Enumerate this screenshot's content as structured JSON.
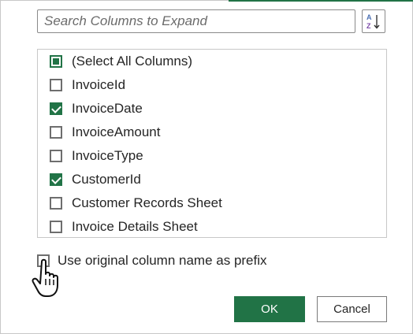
{
  "search": {
    "placeholder": "Search Columns to Expand",
    "value": ""
  },
  "sort_button": {
    "icon": "sort-az-icon",
    "letters_top": "A",
    "letters_bottom": "Z"
  },
  "columns": [
    {
      "label": "(Select All Columns)",
      "state": "indeterminate"
    },
    {
      "label": "InvoiceId",
      "state": "unchecked"
    },
    {
      "label": "InvoiceDate",
      "state": "checked"
    },
    {
      "label": "InvoiceAmount",
      "state": "unchecked"
    },
    {
      "label": "InvoiceType",
      "state": "unchecked"
    },
    {
      "label": "CustomerId",
      "state": "checked"
    },
    {
      "label": "Customer Records Sheet",
      "state": "unchecked"
    },
    {
      "label": "Invoice Details Sheet",
      "state": "unchecked"
    }
  ],
  "prefix_option": {
    "label": "Use original column name as prefix",
    "state": "unchecked"
  },
  "buttons": {
    "ok": "OK",
    "cancel": "Cancel"
  },
  "colors": {
    "accent": "#217346",
    "border": "#c8c8c8",
    "text": "#252525"
  }
}
